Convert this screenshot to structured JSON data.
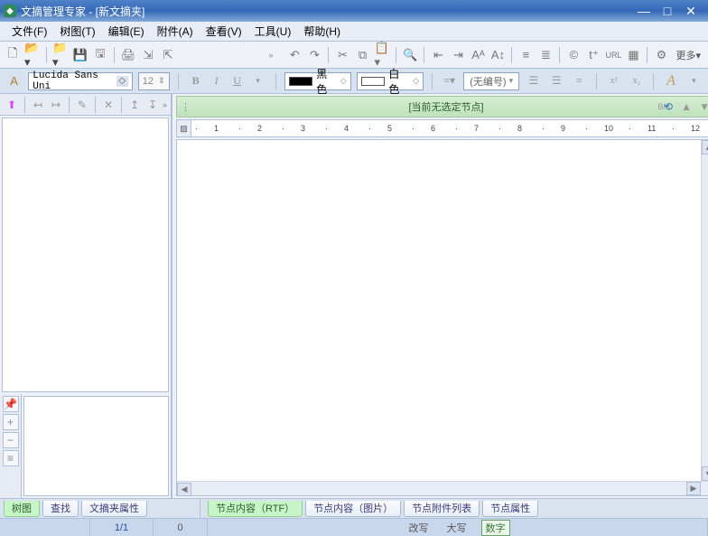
{
  "title": "文摘管理专家 - [新文摘夹]",
  "menu": {
    "file": "文件(F)",
    "tree": "树图(T)",
    "edit": "编辑(E)",
    "attach": "附件(A)",
    "view": "查看(V)",
    "tool": "工具(U)",
    "help": "帮助(H)"
  },
  "toolbar": {
    "more": "更多"
  },
  "format": {
    "font": "Lucida Sans Uni",
    "size": "12",
    "color_label_fg": "黑色",
    "color_label_bg": "白色",
    "numbering": "(无编号)"
  },
  "node_header": {
    "text": "[当前无选定节点]",
    "bm": "BM"
  },
  "ruler_units": [
    "1",
    "2",
    "3",
    "4",
    "5",
    "6",
    "7",
    "8",
    "9",
    "10",
    "11",
    "12"
  ],
  "left_tabs": {
    "tree": "树图",
    "find": "查找",
    "folder_props": "文摘夹属性"
  },
  "right_tabs": {
    "rtf": "节点内容（RTF）",
    "image": "节点内容（图片）",
    "attach_list": "节点附件列表",
    "node_props": "节点属性"
  },
  "status": {
    "page": "1/1",
    "col": "0",
    "overwrite": "改写",
    "caps": "大写",
    "num": "数字"
  }
}
